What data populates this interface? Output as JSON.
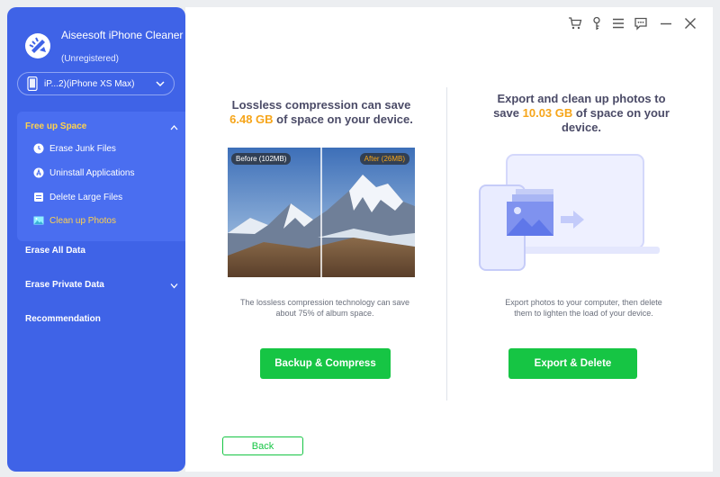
{
  "app": {
    "title": "Aiseesoft iPhone Cleaner",
    "status": "(Unregistered)"
  },
  "device": {
    "label": "iP...2)(iPhone XS Max)"
  },
  "sidebar": {
    "group_label": "Free up Space",
    "items": [
      {
        "label": "Erase Junk Files",
        "icon": "clock-icon"
      },
      {
        "label": "Uninstall Applications",
        "icon": "app-store-icon"
      },
      {
        "label": "Delete Large Files",
        "icon": "file-icon"
      },
      {
        "label": "Clean up Photos",
        "icon": "photo-icon",
        "active": true
      }
    ],
    "main_items": [
      {
        "label": "Erase All Data"
      },
      {
        "label": "Erase Private Data"
      },
      {
        "label": "Recommendation"
      }
    ]
  },
  "topbar": {
    "icons": [
      "cart-icon",
      "key-icon",
      "menu-icon",
      "feedback-icon",
      "minimize-icon",
      "close-icon"
    ]
  },
  "left_panel": {
    "title_line1": "Lossless compression can save",
    "highlight": "6.48 GB",
    "title_line2_rest": " of space on your device.",
    "before_badge": "Before (102MB)",
    "after_badge": "After (26MB)",
    "description_line1": "The lossless compression technology can save",
    "description_line2": "about 75% of album space.",
    "button": "Backup & Compress"
  },
  "right_panel": {
    "title_line1": "Export and clean up photos to",
    "title_line2_pre": "save ",
    "highlight": "10.03 GB",
    "title_line2_rest": " of space on your",
    "title_line3": "device.",
    "description_line1": "Export photos to your computer, then delete",
    "description_line2": "them to lighten the load of your device.",
    "button": "Export & Delete"
  },
  "back_button": "Back",
  "colors": {
    "sidebar": "#3f63e7",
    "accent_yellow": "#ffd24d",
    "highlight_orange": "#f6a51a",
    "green": "#16c544"
  }
}
